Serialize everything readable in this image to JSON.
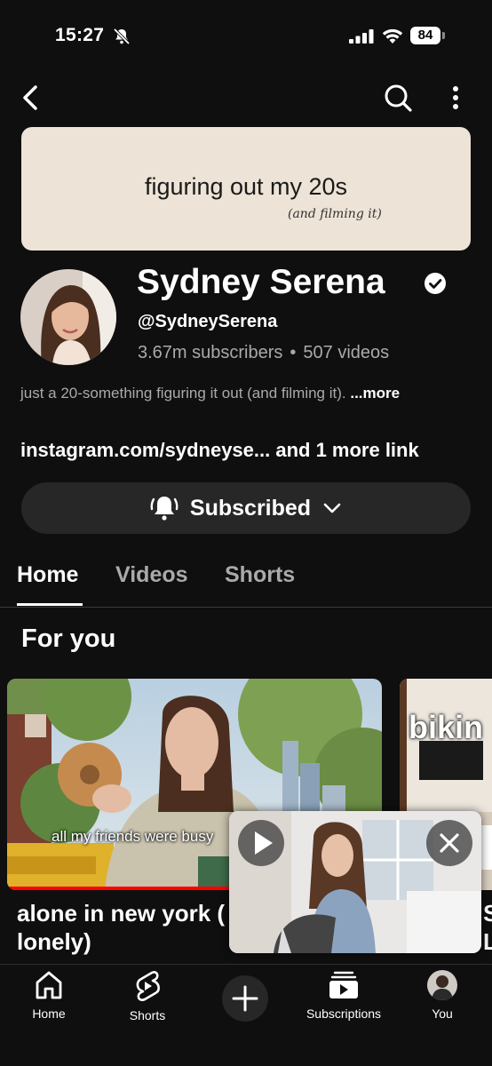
{
  "status_bar": {
    "time": "15:27",
    "battery": "84"
  },
  "banner": {
    "title": "figuring out my 20s",
    "subtitle": "(and filming it)"
  },
  "channel": {
    "name": "Sydney Serena",
    "handle": "@SydneySerena",
    "subscribers": "3.67m subscribers",
    "videos": "507 videos",
    "description": "just a 20-something figuring it out (and filming it).",
    "more_label": "...more",
    "links": "instagram.com/sydneyse... and 1 more link",
    "subscribe_label": "Subscribed"
  },
  "tabs": [
    {
      "label": "Home",
      "active": true
    },
    {
      "label": "Videos",
      "active": false
    },
    {
      "label": "Shorts",
      "active": false
    }
  ],
  "section": {
    "title": "For you"
  },
  "videos": [
    {
      "thumb_caption": "all my friends were busy",
      "title": "alone in new york (",
      "title_line2": "lonely)",
      "progress_percent": 100
    },
    {
      "thumb_caption": "bikin",
      "title": "S",
      "title_line2": "L"
    }
  ],
  "bottom_nav": [
    {
      "label": "Home",
      "icon": "home-icon"
    },
    {
      "label": "Shorts",
      "icon": "shorts-icon"
    },
    {
      "label": "",
      "icon": "create-icon"
    },
    {
      "label": "Subscriptions",
      "icon": "subscriptions-icon"
    },
    {
      "label": "You",
      "icon": "avatar"
    }
  ],
  "colors": {
    "background": "#0f0f0f",
    "accent": "#ff0000",
    "muted_text": "#aaaaaa",
    "chip": "#272727"
  }
}
